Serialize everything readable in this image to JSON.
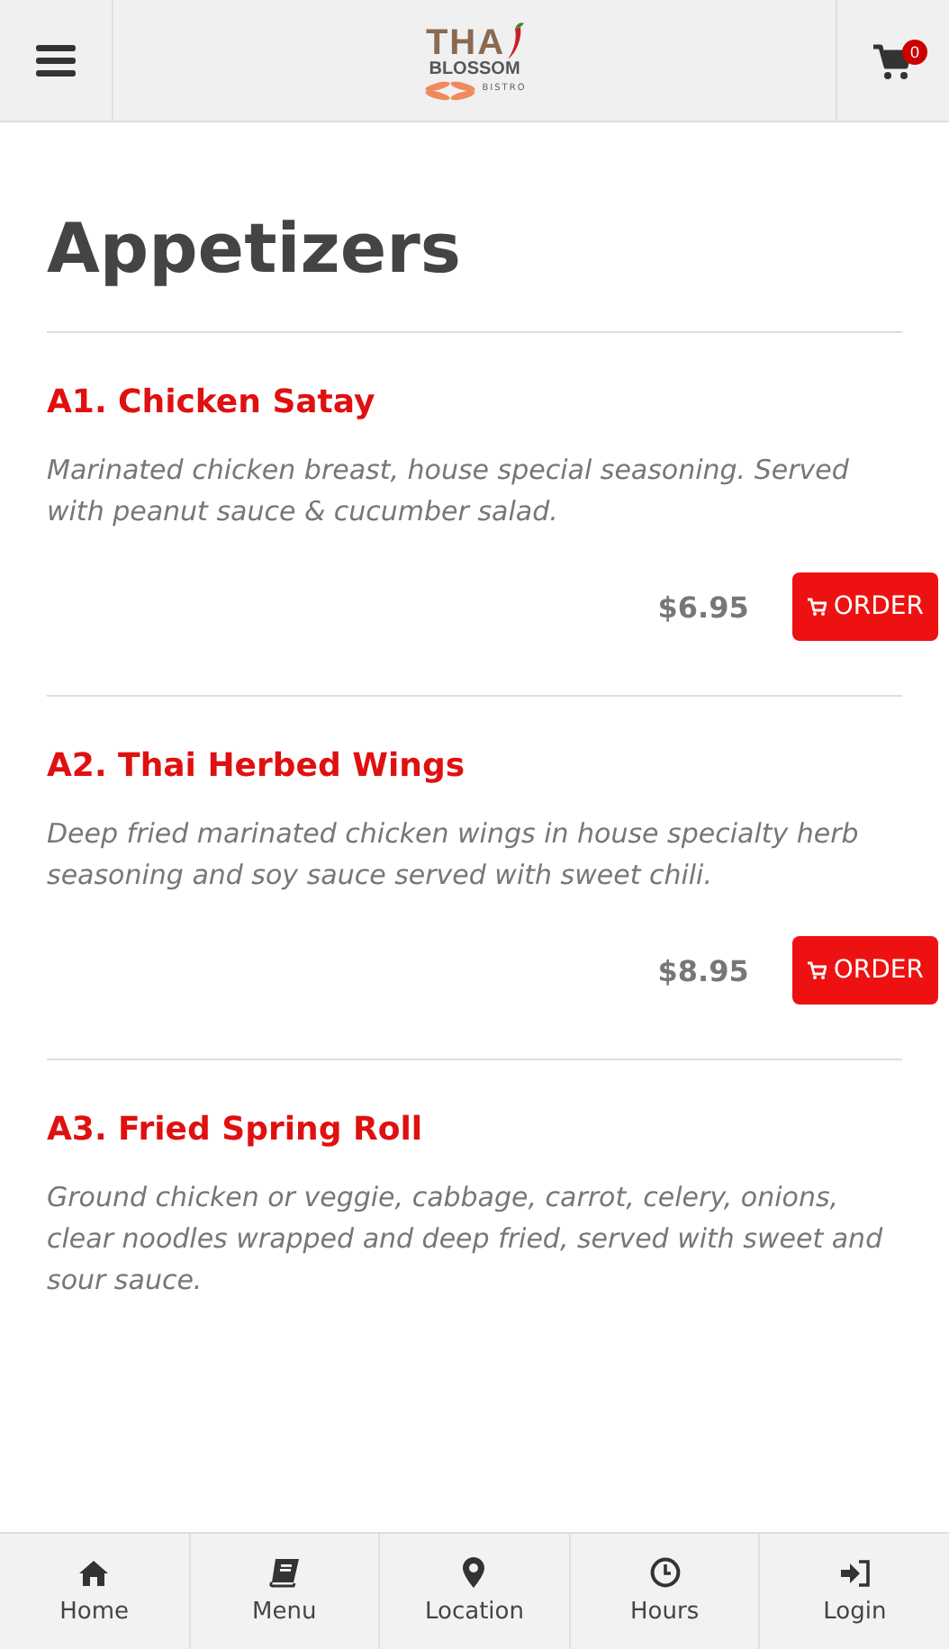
{
  "header": {
    "logo": {
      "line_1": "THA",
      "line_2": "BLOSSOM",
      "line_3": "BISTRO"
    },
    "cart_count": "0"
  },
  "section_title": "Appetizers",
  "items": [
    {
      "name": "A1. Chicken Satay",
      "description": "Marinated chicken breast, house special seasoning. Served with peanut sauce & cucumber salad.",
      "price": "$6.95",
      "button": "ORDER"
    },
    {
      "name": "A2. Thai Herbed Wings",
      "description": "Deep fried marinated chicken wings in house specialty herb seasoning and soy sauce served with sweet chili.",
      "price": "$8.95",
      "button": "ORDER"
    },
    {
      "name": "A3. Fried Spring Roll",
      "description": "Ground chicken or veggie, cabbage, carrot, celery, onions, clear noodles wrapped and deep fried, served with sweet and sour sauce."
    }
  ],
  "bottom_nav": [
    {
      "kind": "home",
      "label": "Home"
    },
    {
      "kind": "book",
      "label": "Menu"
    },
    {
      "kind": "pin",
      "label": "Location"
    },
    {
      "kind": "clock",
      "label": "Hours"
    },
    {
      "kind": "login",
      "label": "Login"
    }
  ]
}
